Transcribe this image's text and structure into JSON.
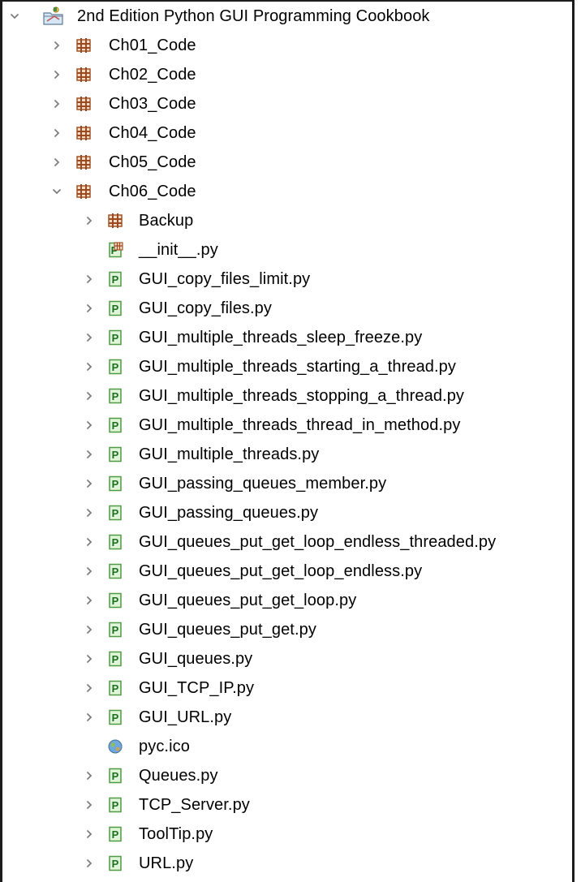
{
  "colors": {
    "package": "#9a4a1e",
    "python_file_fill": "#e0f4d7",
    "python_file_border": "#4f9a45",
    "python_letter": "#1d6f24",
    "chevron": "#7b7b7b"
  },
  "tree": {
    "project": {
      "label": "2nd Edition Python GUI Programming Cookbook",
      "icon": "python-project-icon",
      "expanded": true
    },
    "chapters": [
      {
        "label": "Ch01_Code",
        "icon": "package-icon",
        "expanded": false
      },
      {
        "label": "Ch02_Code",
        "icon": "package-icon",
        "expanded": false
      },
      {
        "label": "Ch03_Code",
        "icon": "package-icon",
        "expanded": false
      },
      {
        "label": "Ch04_Code",
        "icon": "package-icon",
        "expanded": false
      },
      {
        "label": "Ch05_Code",
        "icon": "package-icon",
        "expanded": false
      },
      {
        "label": "Ch06_Code",
        "icon": "package-icon",
        "expanded": true
      }
    ],
    "ch06_children": [
      {
        "label": "Backup",
        "icon": "package-icon",
        "expandable": true
      },
      {
        "label": "__init__.py",
        "icon": "init-module-icon",
        "expandable": false
      },
      {
        "label": "GUI_copy_files_limit.py",
        "icon": "python-file-icon",
        "expandable": true
      },
      {
        "label": "GUI_copy_files.py",
        "icon": "python-file-icon",
        "expandable": true
      },
      {
        "label": "GUI_multiple_threads_sleep_freeze.py",
        "icon": "python-file-icon",
        "expandable": true
      },
      {
        "label": "GUI_multiple_threads_starting_a_thread.py",
        "icon": "python-file-icon",
        "expandable": true
      },
      {
        "label": "GUI_multiple_threads_stopping_a_thread.py",
        "icon": "python-file-icon",
        "expandable": true
      },
      {
        "label": "GUI_multiple_threads_thread_in_method.py",
        "icon": "python-file-icon",
        "expandable": true
      },
      {
        "label": "GUI_multiple_threads.py",
        "icon": "python-file-icon",
        "expandable": true
      },
      {
        "label": "GUI_passing_queues_member.py",
        "icon": "python-file-icon",
        "expandable": true
      },
      {
        "label": "GUI_passing_queues.py",
        "icon": "python-file-icon",
        "expandable": true
      },
      {
        "label": "GUI_queues_put_get_loop_endless_threaded.py",
        "icon": "python-file-icon",
        "expandable": true
      },
      {
        "label": "GUI_queues_put_get_loop_endless.py",
        "icon": "python-file-icon",
        "expandable": true
      },
      {
        "label": "GUI_queues_put_get_loop.py",
        "icon": "python-file-icon",
        "expandable": true
      },
      {
        "label": "GUI_queues_put_get.py",
        "icon": "python-file-icon",
        "expandable": true
      },
      {
        "label": "GUI_queues.py",
        "icon": "python-file-icon",
        "expandable": true
      },
      {
        "label": "GUI_TCP_IP.py",
        "icon": "python-file-icon",
        "expandable": true
      },
      {
        "label": "GUI_URL.py",
        "icon": "python-file-icon",
        "expandable": true
      },
      {
        "label": "pyc.ico",
        "icon": "globe-file-icon",
        "expandable": false
      },
      {
        "label": "Queues.py",
        "icon": "python-file-icon",
        "expandable": true
      },
      {
        "label": "TCP_Server.py",
        "icon": "python-file-icon",
        "expandable": true
      },
      {
        "label": "ToolTip.py",
        "icon": "python-file-icon",
        "expandable": true
      },
      {
        "label": "URL.py",
        "icon": "python-file-icon",
        "expandable": true
      }
    ]
  }
}
